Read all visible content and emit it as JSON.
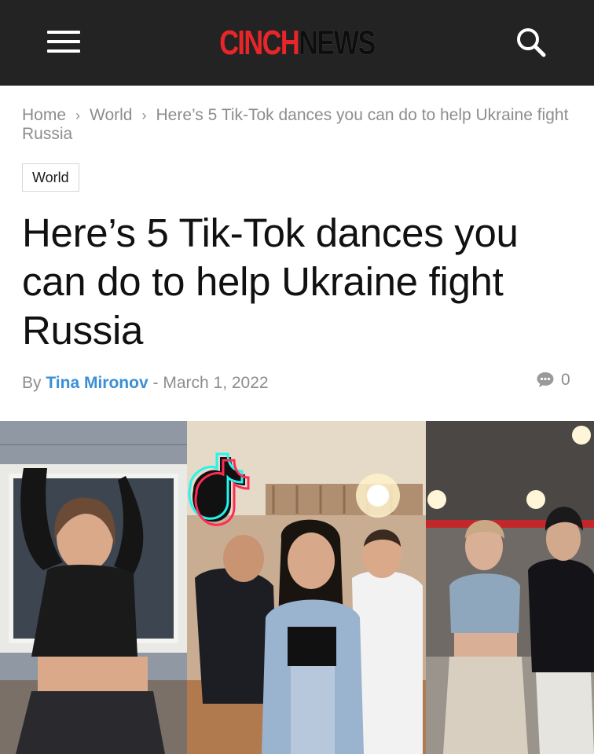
{
  "header": {
    "logo_part1": "CINCH",
    "logo_part2": "NEWS",
    "menu_icon": "hamburger-menu-icon",
    "search_icon": "search-icon"
  },
  "breadcrumb": {
    "home": "Home",
    "section": "World",
    "current": "Here’s 5 Tik-Tok dances you can do to help Ukraine fight Russia"
  },
  "category": "World",
  "article": {
    "title": "Here’s 5 Tik-Tok dances you can do to help Ukraine fight Russia",
    "by_label": "By",
    "author": "Tina Mironov",
    "dash": "-",
    "date": "March 1, 2022",
    "comment_count": "0"
  },
  "colors": {
    "header_bg": "#232323",
    "logo_red": "#e8262a",
    "author_link": "#3a8fd6",
    "muted_text": "#8d8d8d"
  }
}
